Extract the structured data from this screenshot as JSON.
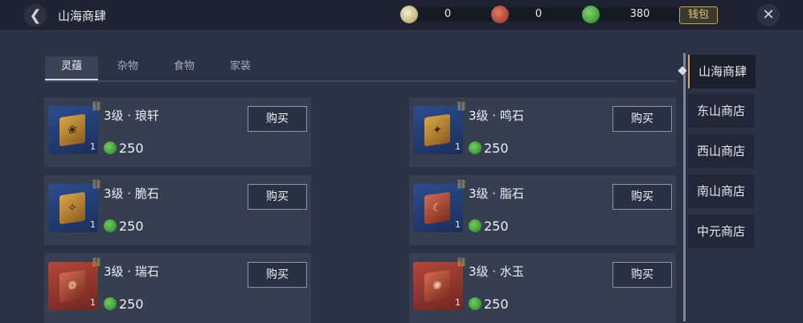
{
  "header": {
    "title": "山海商肆",
    "back_icon": "back-arrow-icon",
    "wallet_label": "钱包",
    "close_icon": "close-icon",
    "currencies": [
      {
        "name": "jade-pendant-icon",
        "value": "0",
        "color": "#d8cfa0"
      },
      {
        "name": "red-swirl-icon",
        "value": "0",
        "color": "#c44a3a"
      },
      {
        "name": "green-jade-icon",
        "value": "380",
        "color": "#4aa84a"
      }
    ]
  },
  "tabs": [
    {
      "label": "灵蕴",
      "active": true
    },
    {
      "label": "杂物",
      "active": false
    },
    {
      "label": "食物",
      "active": false
    },
    {
      "label": "家装",
      "active": false
    }
  ],
  "items": [
    {
      "name": "3级 · 琅轩",
      "price": "250",
      "qty": "1",
      "buy_label": "购买",
      "thumb": "blue"
    },
    {
      "name": "3级 · 鸣石",
      "price": "250",
      "qty": "1",
      "buy_label": "购买",
      "thumb": "blue"
    },
    {
      "name": "3级 · 脆石",
      "price": "250",
      "qty": "1",
      "buy_label": "购买",
      "thumb": "blue"
    },
    {
      "name": "3级 · 脂石",
      "price": "250",
      "qty": "1",
      "buy_label": "购买",
      "thumb": "red"
    },
    {
      "name": "3级 · 瑞石",
      "price": "250",
      "qty": "1",
      "buy_label": "购买",
      "thumb": "red"
    },
    {
      "name": "3级 · 水玉",
      "price": "250",
      "qty": "1",
      "buy_label": "购买",
      "thumb": "red"
    }
  ],
  "shops": [
    {
      "label": "山海商肆",
      "active": true
    },
    {
      "label": "东山商店",
      "active": false
    },
    {
      "label": "西山商店",
      "active": false
    },
    {
      "label": "南山商店",
      "active": false
    },
    {
      "label": "中元商店",
      "active": false
    }
  ]
}
